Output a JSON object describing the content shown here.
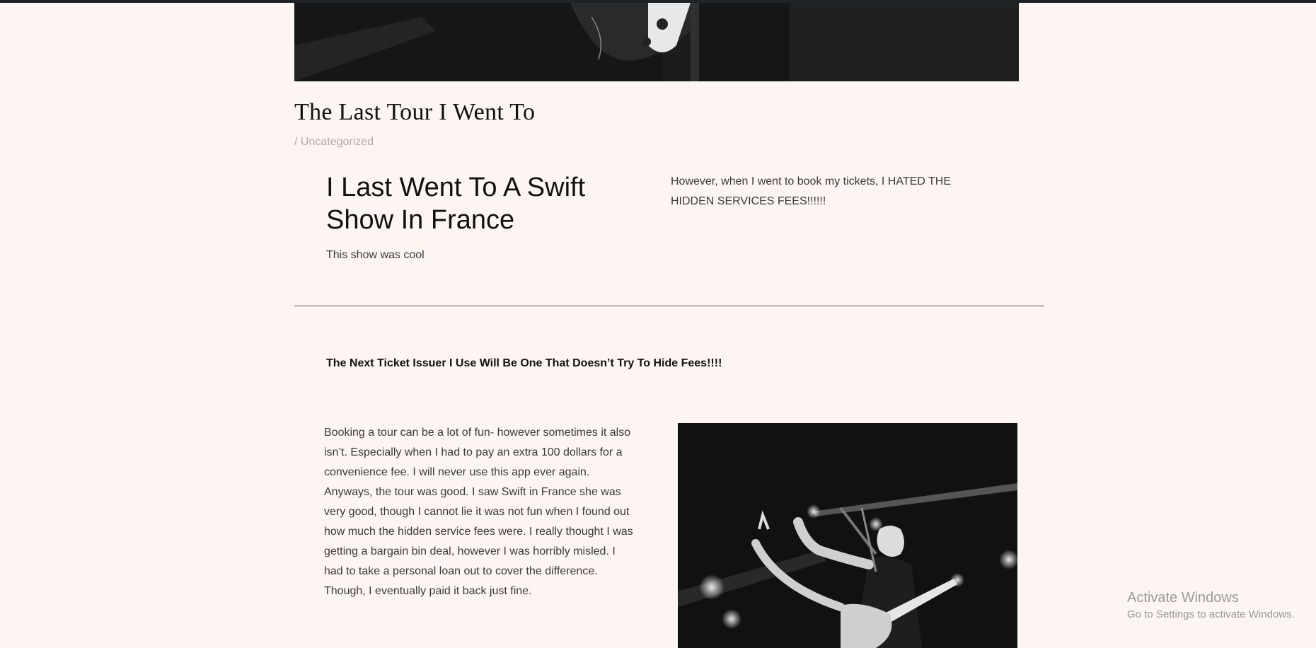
{
  "post": {
    "title": "The Last Tour I Went To",
    "meta_separator": "/",
    "category": "Uncategorized"
  },
  "intro": {
    "heading": "I Last Went To A Swift Show In France",
    "text": "This show was cool",
    "fees_text": "However, when I went to book my tickets, I HATED THE HIDDEN SERVICES FEES!!!!!!"
  },
  "next_issuer": "The Next Ticket Issuer I Use Will Be One That Doesn’t Try To Hide Fees!!!!",
  "body_text": "Booking a tour can be a lot of fun- however sometimes it also isn’t. Especially when I had to pay an extra 100 dollars for a convenience fee. I will never use this app ever again. Anyways, the tour was good. I saw Swift in France she was very good, though I cannot lie it was not fun when I found out how much the hidden service fees were. I really thought I was getting a bargain bin deal, however I was horribly misled. I had to take a personal loan out to cover the difference. Though, I eventually paid it back just fine.",
  "watermark": {
    "title": "Activate Windows",
    "subtitle": "Go to Settings to activate Windows."
  },
  "colors": {
    "background": "#fdf5f2",
    "category": "#b9a6a6",
    "heading": "#111111",
    "text": "#3a3a3a"
  }
}
